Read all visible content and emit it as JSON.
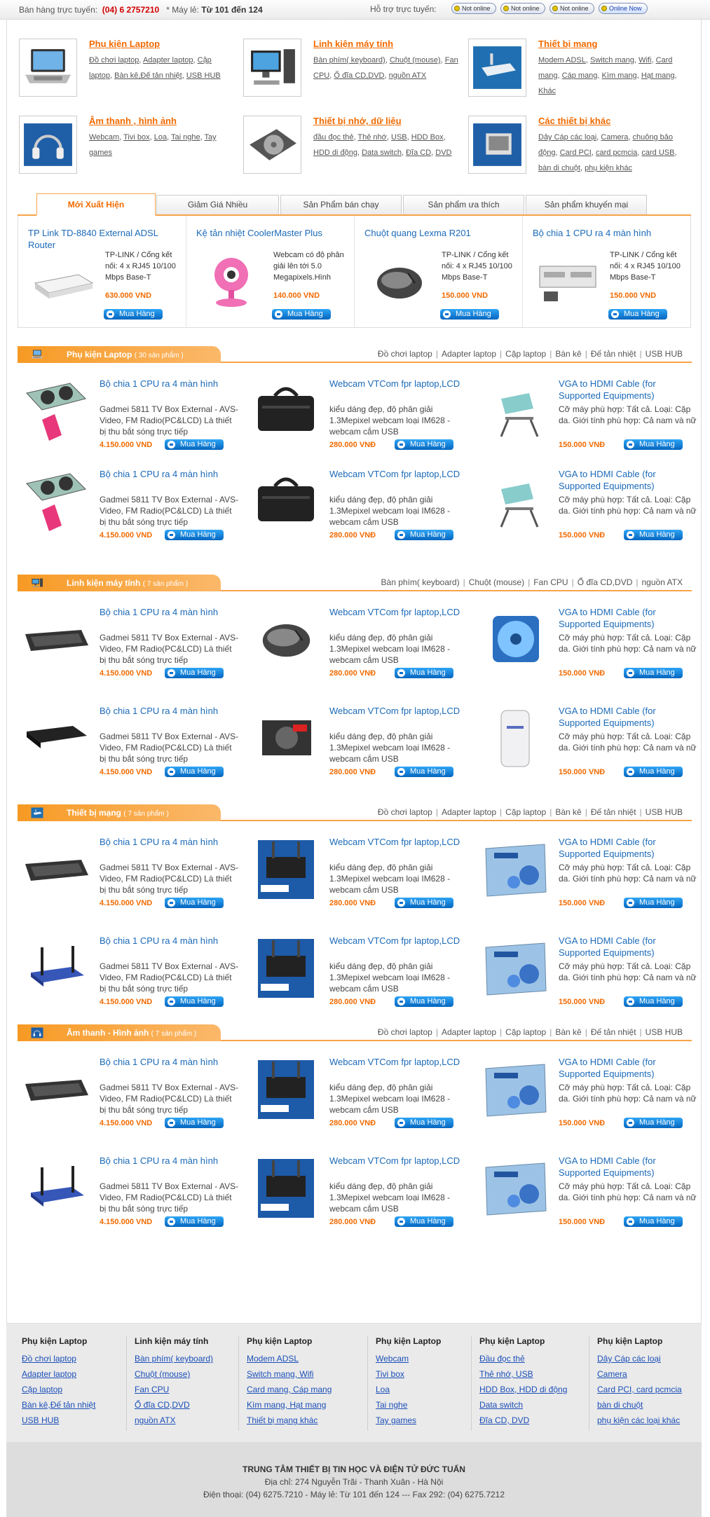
{
  "topbar": {
    "sales_label": "Bán hàng trực tuyến:",
    "phone": "(04) 6 2757210",
    "ext_label": "* Máy lẻ:",
    "ext_value": "Từ 101 đến 124",
    "support_label": "Hỗ trợ trực tuyến:",
    "ym": [
      "Not online",
      "Not online",
      "Not online",
      "Online Now"
    ]
  },
  "categories": [
    {
      "title": "Phụ kiện Laptop",
      "icon": "laptop-icon",
      "links": [
        "Đồ chơi laptop",
        "Adapter laptop",
        "Cặp laptop",
        "Bàn kê,Đế tản nhiệt",
        "USB HUB"
      ]
    },
    {
      "title": "Linh kiện máy tính",
      "icon": "desktop-icon",
      "links": [
        "Bàn phím( keyboard)",
        "Chuột (mouse)",
        "Fan CPU",
        "Ổ đĩa CD,DVD",
        "nguồn ATX"
      ]
    },
    {
      "title": "Thiết bị mạng",
      "icon": "network-icon",
      "links": [
        "Modem ADSL",
        "Switch mang",
        "Wifi",
        "Card mang",
        "Cáp mang",
        "Kìm mang",
        "Hạt mang",
        "Khác"
      ]
    },
    {
      "title": "Âm thanh , hình ảnh",
      "icon": "headphones-icon",
      "links": [
        "Webcam",
        "Tivi box",
        "Loa",
        "Tai nghe",
        "Tay games"
      ]
    },
    {
      "title": "Thiết bị nhớ, dữ liệu",
      "icon": "harddisk-icon",
      "links": [
        "đầu đọc thẻ",
        "Thẻ nhớ",
        "USB",
        "HDD Box",
        "HDD di động",
        "Data switch",
        "Đĩa CD",
        "DVD"
      ]
    },
    {
      "title": "Các thiết bị khác",
      "icon": "folder-icon",
      "links": [
        "Dây Cáp các loại",
        "Camera",
        "chuông bảo động",
        "Card PCI",
        "card pcmcia",
        "card USB",
        "bàn di chuột",
        "phụ kiện khác"
      ]
    }
  ],
  "tabs": [
    "Mới Xuất Hiện",
    "Giảm Giá Nhiều",
    "Sản Phẩm bán chạy",
    "Sản phẩm ưa thích",
    "Sản phẩm khuyến mại"
  ],
  "featured": [
    {
      "title": "TP Link TD-8840 External ADSL Router",
      "desc": "TP-LINK / Cổng kết nối: 4 x RJ45 10/100 Mbps Base-T",
      "price": "630.000 VND",
      "img": "router"
    },
    {
      "title": "Kệ tản nhiệt CoolerMaster Plus",
      "desc": "Webcam có độ phân giải lên tới 5.0 Megapixels.Hình",
      "price": "140.000 VND",
      "img": "webcam"
    },
    {
      "title": "Chuột quang Lexma R201",
      "desc": "TP-LINK / Cổng kết nối: 4 x RJ45 10/100 Mbps Base-T",
      "price": "150.000 VND",
      "img": "mouse"
    },
    {
      "title": "Bộ chia 1 CPU ra 4 màn hình",
      "desc": "TP-LINK / Cổng kết nối: 4 x RJ45 10/100 Mbps Base-T",
      "price": "150.000 VND",
      "img": "kvm"
    }
  ],
  "buy_label": "Mua Hàng",
  "sections": [
    {
      "name": "Phụ kiện Laptop",
      "count": "( 30 sản phẩm )",
      "icon": "laptop-icon",
      "links": [
        "Đồ chơi laptop",
        "Adapter laptop",
        "Cặp laptop",
        "Bàn kê",
        "Đế tản nhiệt",
        "USB HUB"
      ],
      "rows": [
        [
          {
            "title": "Bộ chia 1 CPU ra 4 màn hình",
            "desc": "Gadmei 5811 TV Box External - AVS-Video, FM Radio(PC&LCD) Là thiết bị thu bắt sóng trực tiếp",
            "price": "4.150.000 VND",
            "img": "coolpad"
          },
          {
            "title": "Webcam VTCom fpr laptop,LCD",
            "desc": "kiểu dáng đẹp, độ phân giải 1.3Mepixel webcam loại IM628 - webcam cắm USB",
            "price": "280.000 VNĐ",
            "img": "bag"
          },
          {
            "title": "VGA to HDMI Cable (for Supported Equipments)",
            "desc": "Cỡ máy phù hợp: Tất cả. Loại: Cặp da. Giới tính phù hợp: Cả nam và nữ",
            "price": "150.000 VNĐ",
            "img": "stand"
          }
        ],
        [
          {
            "title": "Bộ chia 1 CPU ra 4 màn hình",
            "desc": "Gadmei 5811 TV Box External - AVS-Video, FM Radio(PC&LCD) Là thiết bị thu bắt sóng trực tiếp",
            "price": "4.150.000 VND",
            "img": "coolpad"
          },
          {
            "title": "Webcam VTCom fpr laptop,LCD",
            "desc": "kiểu dáng đẹp, độ phân giải 1.3Mepixel webcam loại IM628 - webcam cắm USB",
            "price": "280.000 VNĐ",
            "img": "bag"
          },
          {
            "title": "VGA to HDMI Cable (for Supported Equipments)",
            "desc": "Cỡ máy phù hợp: Tất cả. Loại: Cặp da. Giới tính phù hợp: Cả nam và nữ",
            "price": "150.000 VNĐ",
            "img": "stand"
          }
        ]
      ]
    },
    {
      "name": "Linh kiện máy tính",
      "count": "( 7 sản phẩm )",
      "icon": "desktop-icon",
      "links": [
        "Bàn phím( keyboard)",
        "Chuột (mouse)",
        "Fan CPU",
        "Ổ đĩa CD,DVD",
        "nguồn ATX"
      ],
      "rows": [
        [
          {
            "title": "Bộ chia 1 CPU ra 4 màn hình",
            "desc": "Gadmei 5811 TV Box External - AVS-Video, FM Radio(PC&LCD) Là thiết bị thu bắt sóng trực tiếp",
            "price": "4.150.000 VND",
            "img": "keyboard"
          },
          {
            "title": "Webcam VTCom fpr laptop,LCD",
            "desc": "kiểu dáng đẹp, độ phân giải 1.3Mepixel webcam loại IM628 - webcam cắm USB",
            "price": "280.000 VNĐ",
            "img": "mouse"
          },
          {
            "title": "VGA to HDMI Cable (for Supported Equipments)",
            "desc": "Cỡ máy phù hợp: Tất cả. Loại: Cặp da. Giới tính phù hợp: Cả nam và nữ",
            "price": "150.000 VNĐ",
            "img": "fan"
          }
        ],
        [
          {
            "title": "Bộ chia 1 CPU ra 4 màn hình",
            "desc": "Gadmei 5811 TV Box External - AVS-Video, FM Radio(PC&LCD) Là thiết bị thu bắt sóng trực tiếp",
            "price": "4.150.000 VND",
            "img": "dvd"
          },
          {
            "title": "Webcam VTCom fpr laptop,LCD",
            "desc": "kiểu dáng đẹp, độ phân giải 1.3Mepixel webcam loại IM628 - webcam cắm USB",
            "price": "280.000 VNĐ",
            "img": "psu"
          },
          {
            "title": "VGA to HDMI Cable (for Supported Equipments)",
            "desc": "Cỡ máy phù hợp: Tất cả. Loại: Cặp da. Giới tính phù hợp: Cả nam và nữ",
            "price": "150.000 VNĐ",
            "img": "ups"
          }
        ]
      ]
    },
    {
      "name": "Thiết bị mạng",
      "count": "( 7 sản phẩm )",
      "icon": "network-icon",
      "links": [
        "Đồ chơi laptop",
        "Adapter laptop",
        "Cặp laptop",
        "Bàn kê",
        "Đế tản nhiệt",
        "USB HUB"
      ],
      "rows": [
        [
          {
            "title": "Bộ chia 1 CPU ra 4 màn hình",
            "desc": "Gadmei 5811 TV Box External - AVS-Video, FM Radio(PC&LCD) Là thiết bị thu bắt sóng trực tiếp",
            "price": "4.150.000 VND",
            "img": "keyboard"
          },
          {
            "title": "Webcam VTCom fpr laptop,LCD",
            "desc": "kiểu dáng đẹp, độ phân giải 1.3Mepixel webcam loại IM628 - webcam cắm USB",
            "price": "280.000 VNĐ",
            "img": "linksys"
          },
          {
            "title": "VGA to HDMI Cable (for Supported Equipments)",
            "desc": "Cỡ máy phù hợp: Tất cả. Loại: Cặp da. Giới tính phù hợp: Cả nam và nữ",
            "price": "150.000 VNĐ",
            "img": "tplink"
          }
        ],
        [
          {
            "title": "Bộ chia 1 CPU ra 4 màn hình",
            "desc": "Gadmei 5811 TV Box External - AVS-Video, FM Radio(PC&LCD) Là thiết bị thu bắt sóng trực tiếp",
            "price": "4.150.000 VND",
            "img": "wifi"
          },
          {
            "title": "Webcam VTCom fpr laptop,LCD",
            "desc": "kiểu dáng đẹp, độ phân giải 1.3Mepixel webcam loại IM628 - webcam cắm USB",
            "price": "280.000 VNĐ",
            "img": "linksys"
          },
          {
            "title": "VGA to HDMI Cable (for Supported Equipments)",
            "desc": "Cỡ máy phù hợp: Tất cả. Loại: Cặp da. Giới tính phù hợp: Cả nam và nữ",
            "price": "150.000 VNĐ",
            "img": "tplink"
          }
        ]
      ]
    },
    {
      "name": "Âm thanh - Hình ảnh",
      "count": "( 7 sản phẩm )",
      "icon": "headphones-icon",
      "links": [
        "Đồ chơi laptop",
        "Adapter laptop",
        "Cặp laptop",
        "Bàn kê",
        "Đế tản nhiệt",
        "USB HUB"
      ],
      "rows": [
        [
          {
            "title": "Bộ chia 1 CPU ra 4 màn hình",
            "desc": "Gadmei 5811 TV Box External - AVS-Video, FM Radio(PC&LCD) Là thiết bị thu bắt sóng trực tiếp",
            "price": "4.150.000 VND",
            "img": "keyboard"
          },
          {
            "title": "Webcam VTCom fpr laptop,LCD",
            "desc": "kiểu dáng đẹp, độ phân giải 1.3Mepixel webcam loại IM628 - webcam cắm USB",
            "price": "280.000 VNĐ",
            "img": "linksys"
          },
          {
            "title": "VGA to HDMI Cable (for Supported Equipments)",
            "desc": "Cỡ máy phù hợp: Tất cả. Loại: Cặp da. Giới tính phù hợp: Cả nam và nữ",
            "price": "150.000 VNĐ",
            "img": "tplink"
          }
        ],
        [
          {
            "title": "Bộ chia 1 CPU ra 4 màn hình",
            "desc": "Gadmei 5811 TV Box External - AVS-Video, FM Radio(PC&LCD) Là thiết bị thu bắt sóng trực tiếp",
            "price": "4.150.000 VND",
            "img": "wifi"
          },
          {
            "title": "Webcam VTCom fpr laptop,LCD",
            "desc": "kiểu dáng đẹp, độ phân giải 1.3Mepixel webcam loại IM628 - webcam cắm USB",
            "price": "280.000 VNĐ",
            "img": "linksys"
          },
          {
            "title": "VGA to HDMI Cable (for Supported Equipments)",
            "desc": "Cỡ máy phù hợp: Tất cả. Loại: Cặp da. Giới tính phù hợp: Cả nam và nữ",
            "price": "150.000 VNĐ",
            "img": "tplink"
          }
        ]
      ]
    }
  ],
  "footer": {
    "columns": [
      {
        "title": "Phụ kiện Laptop",
        "items": [
          "Đồ chơi laptop",
          "Adapter laptop",
          "Cặp laptop",
          "Bàn kê,Đế tản nhiệt",
          "USB HUB"
        ]
      },
      {
        "title": "Linh kiện máy tính",
        "items": [
          "Bàn phím( keyboard)",
          "Chuột (mouse)",
          "Fan CPU",
          "Ổ đĩa CD,DVD",
          "nguồn ATX"
        ]
      },
      {
        "title": "Phụ kiện Laptop",
        "items": [
          "Modem ADSL",
          "Switch mang, Wifi",
          "Card mang, Cáp mang",
          "Kìm mang, Hạt mang",
          "Thiết bị mạng khác"
        ]
      },
      {
        "title": "Phụ kiện Laptop",
        "items": [
          "Webcam",
          "Tivi box",
          "Loa",
          "Tai nghe",
          "Tay games"
        ]
      },
      {
        "title": "Phụ kiện Laptop",
        "items": [
          "Đầu đọc thẻ",
          "Thẻ nhớ, USB",
          "HDD Box, HDD di động",
          "Data switch",
          "Đĩa CD, DVD"
        ]
      },
      {
        "title": "Phụ kiện Laptop",
        "items": [
          "Dây Cáp các loại",
          "Camera",
          "Card PCI, card pcmcia",
          "bàn di chuột",
          "phụ kiện các loại khác"
        ]
      }
    ],
    "company": "TRUNG TÂM THIẾT BỊ TIN HỌC VÀ ĐIỆN TỬ ĐỨC TUẤN",
    "address": "Địa chỉ: 274 Nguyễn Trãi - Thanh Xuân - Hà Nội",
    "phone": "Điện thoại: (04) 6275.7210 - Máy lẻ: Từ 101 đến 124 --- Fax 292: (04) 6275.7212"
  },
  "colors": {
    "accent": "#f16a00",
    "link": "#1b6ab8",
    "buy": "#0a78d8"
  }
}
